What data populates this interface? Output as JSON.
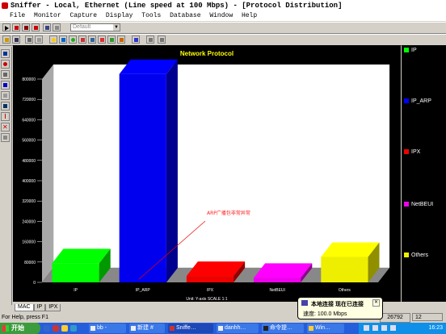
{
  "window": {
    "title": "Sniffer - Local, Ethernet (Line speed at 100 Mbps) - [Protocol Distribution]"
  },
  "menu": [
    "File",
    "Monitor",
    "Capture",
    "Display",
    "Tools",
    "Database",
    "Window",
    "Help"
  ],
  "toolbar": {
    "filter_combo_value": "Default"
  },
  "chart_data": {
    "type": "bar",
    "title": "Network Protocol",
    "categories": [
      "IP",
      "IP_ARP",
      "IPX",
      "NetBEUI",
      "Others"
    ],
    "values": [
      75000,
      820000,
      25000,
      18000,
      100000
    ],
    "colors": [
      "#00ff00",
      "#0000ee",
      "#ee0000",
      "#ee00ee",
      "#eeee00"
    ],
    "yticks": [
      "0",
      "80000",
      "160000",
      "240000",
      "320000",
      "400000",
      "480000",
      "560000",
      "640000",
      "720000",
      "800000"
    ],
    "ylim": [
      0,
      800000
    ],
    "xlabel": "Unit:  Y-axis SCALE 1:1",
    "annotation": "ARP广播包非常异常",
    "legend_position": "right",
    "grid": false
  },
  "legend": [
    "IP",
    "IP_ARP",
    "IPX",
    "NetBEUI",
    "Others"
  ],
  "tabs": [
    "MAC",
    "IP",
    "IPX"
  ],
  "status": {
    "help": "For Help, press F1",
    "field1": "26792",
    "field2": "12"
  },
  "taskbar": {
    "start": "开始",
    "tasks": [
      "bb -",
      "新建 #",
      "Sniffe…",
      "danhh…",
      "命令提…",
      "Win…"
    ],
    "clock": "16:23"
  },
  "balloon": {
    "title": "本地连接  现在已连接",
    "body": "速度: 100.0 Mbps"
  }
}
